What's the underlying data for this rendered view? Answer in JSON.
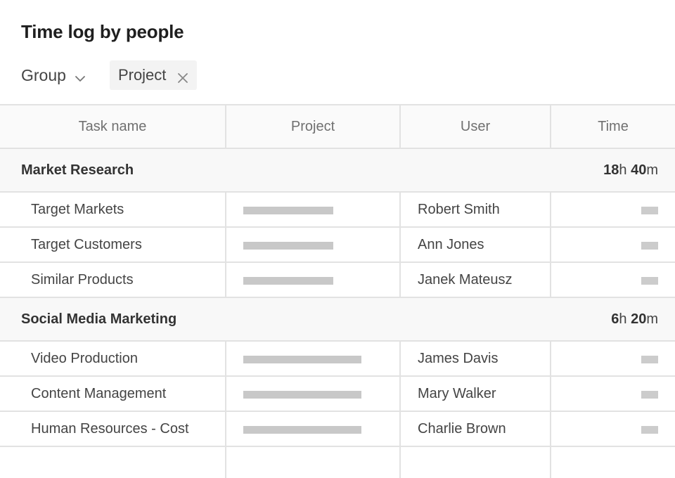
{
  "page": {
    "title": "Time log by people"
  },
  "toolbar": {
    "group_label": "Group",
    "group_icon": "chevron-down-icon",
    "chip_label": "Project",
    "chip_remove_icon": "close-icon"
  },
  "table": {
    "columns": [
      "Task name",
      "Project",
      "User",
      "Time"
    ],
    "groups": [
      {
        "name": "Market Research",
        "time_hours": "18",
        "time_h_unit": "h",
        "time_minutes": "40",
        "time_m_unit": "m",
        "rows": [
          {
            "task": "Target Markets",
            "user": "Robert Smith"
          },
          {
            "task": "Target Customers",
            "user": "Ann Jones"
          },
          {
            "task": "Similar Products",
            "user": "Janek Mateusz"
          }
        ]
      },
      {
        "name": "Social Media Marketing",
        "time_hours": "6",
        "time_h_unit": "h",
        "time_minutes": "20",
        "time_m_unit": "m",
        "rows": [
          {
            "task": "Video Production",
            "user": "James Davis"
          },
          {
            "task": "Content Management",
            "user": "Mary Walker"
          },
          {
            "task": "Human Resources - Cost",
            "user": "Charlie Brown"
          }
        ]
      }
    ]
  },
  "colors": {
    "placeholder_bar": "#c8c8c8",
    "grid": "#e2e2e2",
    "group_bg": "#f8f8f8"
  }
}
